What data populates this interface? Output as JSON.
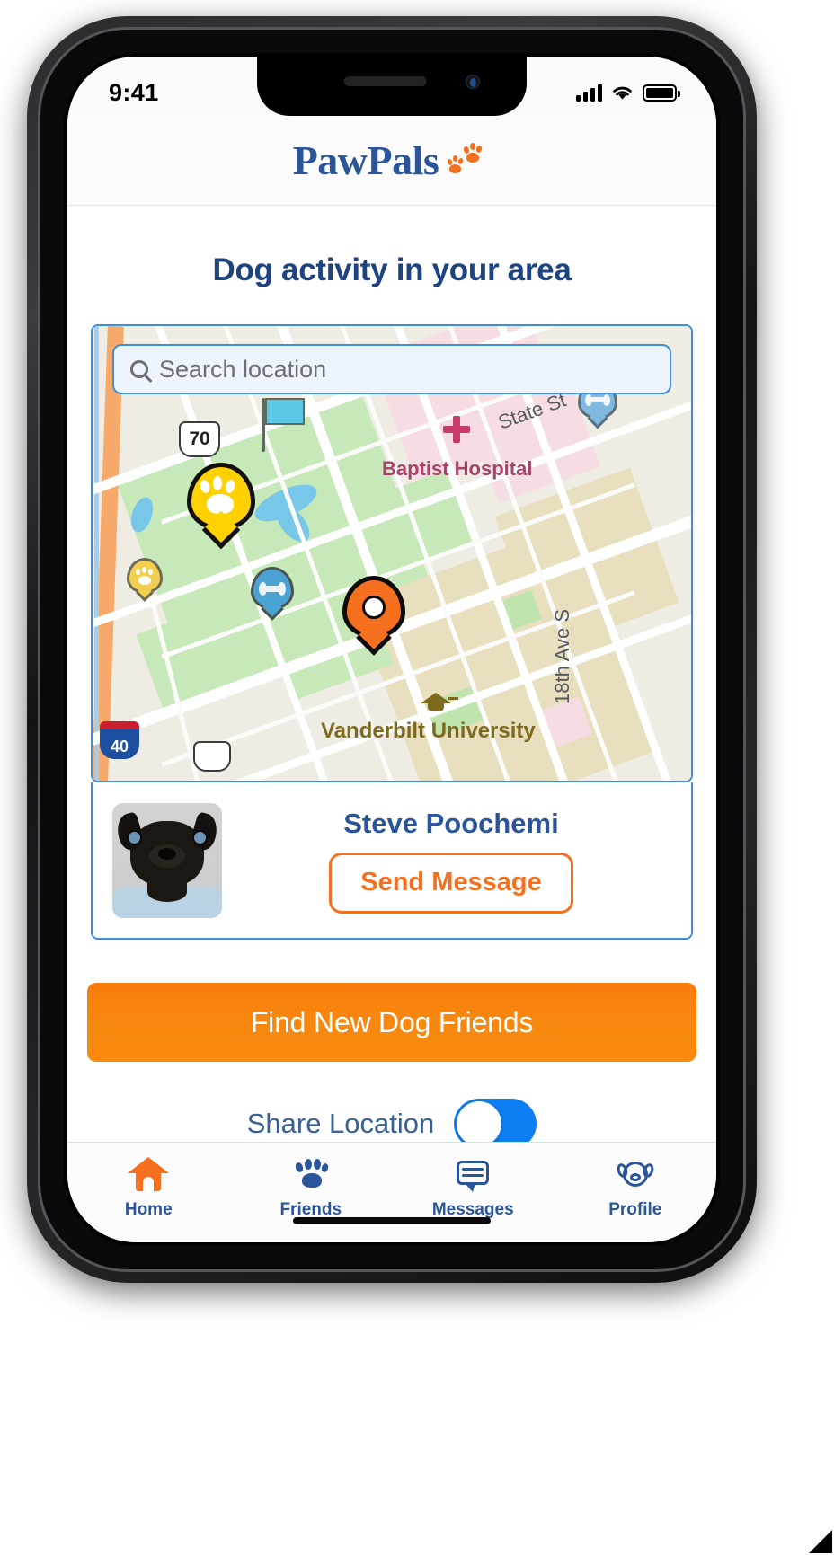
{
  "status_bar": {
    "time": "9:41",
    "signal_icon": "cellular-signal-icon",
    "wifi_icon": "wifi-icon",
    "battery_icon": "battery-icon"
  },
  "header": {
    "brand": "PawPals",
    "logo_icon": "paw-prints-icon",
    "brand_color": "#2a5599",
    "accent_color": "#f4701f"
  },
  "main": {
    "title": "Dog activity in your area"
  },
  "search": {
    "placeholder": "Search location",
    "icon": "search-icon",
    "value": ""
  },
  "map": {
    "labels": {
      "hospital": "Baptist Hospital",
      "university": "Vanderbilt University",
      "state_street": "State St",
      "eighteenth_ave": "18th Ave S"
    },
    "shields": {
      "us_route": "70",
      "interstate": "40"
    },
    "markers": [
      {
        "name": "paw-pin-large",
        "type": "paw",
        "color": "#ffd100"
      },
      {
        "name": "paw-pin-small",
        "type": "paw",
        "color": "#ffd100"
      },
      {
        "name": "bone-pin-left",
        "type": "bone",
        "color": "#4ba3d3"
      },
      {
        "name": "bone-pin-right",
        "type": "bone",
        "color": "#7fb9e0"
      },
      {
        "name": "current-location-pin",
        "type": "location",
        "color": "#f4701f"
      }
    ],
    "poi_icons": {
      "flag": "flag-icon",
      "hospital_cross": "hospital-cross-icon",
      "graduation_cap": "graduation-cap-icon"
    }
  },
  "profile": {
    "avatar_alt": "dog-avatar",
    "name": "Steve Poochemi",
    "message_button": "Send Message"
  },
  "cta": {
    "label": "Find New Dog Friends"
  },
  "share_location": {
    "label": "Share Location",
    "enabled": "true"
  },
  "tabbar": {
    "items": [
      {
        "label": "Home",
        "icon": "home-icon",
        "active": "true"
      },
      {
        "label": "Friends",
        "icon": "paw-icon",
        "active": "false"
      },
      {
        "label": "Messages",
        "icon": "chat-icon",
        "active": "false"
      },
      {
        "label": "Profile",
        "icon": "dog-face-icon",
        "active": "false"
      }
    ]
  }
}
